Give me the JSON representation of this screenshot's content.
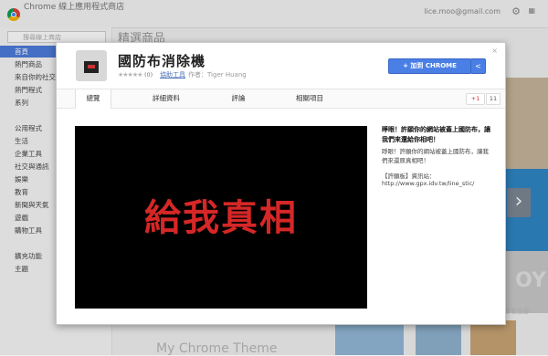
{
  "store": {
    "title": "Chrome 線上應用程式商店",
    "user_email": "lice.moo@gmail.com",
    "search_placeholder": "搜尋線上商店",
    "featured_title": "精選商品",
    "see_all": "查看全部",
    "bottom_theme_title": "My Chrome Theme"
  },
  "sidebar": {
    "items": [
      {
        "label": "首頁",
        "active": true
      },
      {
        "label": "熱門商品",
        "active": false
      },
      {
        "label": "來自你的社交圈",
        "active": false
      },
      {
        "label": "熱門程式",
        "active": false
      },
      {
        "label": "系列",
        "active": false
      },
      {
        "label": "公用程式",
        "active": false
      },
      {
        "label": "生活",
        "active": false
      },
      {
        "label": "企業工具",
        "active": false
      },
      {
        "label": "社交與通訊",
        "active": false
      },
      {
        "label": "娛樂",
        "active": false
      },
      {
        "label": "教育",
        "active": false
      },
      {
        "label": "新聞與天氣",
        "active": false
      },
      {
        "label": "遊戲",
        "active": false
      },
      {
        "label": "購物工具",
        "active": false
      },
      {
        "label": "擴充功能",
        "active": false
      },
      {
        "label": "主題",
        "active": false
      }
    ]
  },
  "dialog": {
    "app_name": "國防布消除機",
    "stars": "★★★★★",
    "rating_count": "(0)",
    "category": "協助工具",
    "author": "作者：Tiger Huang",
    "add_button": "+  加到 CHROME",
    "share_icon": "share-icon",
    "close_glyph": "×",
    "tabs": [
      "總覽",
      "詳細資料",
      "評論",
      "相關項目"
    ],
    "gplus_label": "+1",
    "gplus_count": "11",
    "video_text": "給我真相",
    "desc_bold": "睜眼！許願你的網站被蓋上國防布，讓我們來還給你相吧！",
    "desc_normal": "睜眼！許願你的網站被蓋上國防布，讓我們來還原真相吧！",
    "desc_label": "【許願板】資訊站：",
    "desc_url": "http://www.gpx.idv.tw/line_stic/"
  },
  "colors": {
    "primary_button": "#4a7fe6",
    "highlight_ring": "#d22222",
    "video_text": "#d62727",
    "sidebar_active": "#4d7cdb"
  }
}
